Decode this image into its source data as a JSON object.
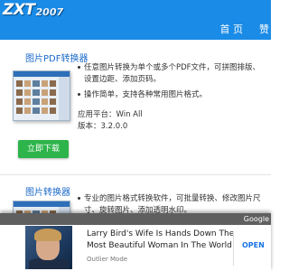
{
  "header": {
    "logo_main": "ZXT",
    "logo_year": "2007",
    "nav": [
      "首 页",
      "赞"
    ]
  },
  "products": [
    {
      "title": "图片PDF转换器",
      "bullets": [
        "任意图片转换为单个或多个PDF文件，可拼图排版、设置边距、添加页码。",
        "操作简单，支持各种常用图片格式。"
      ],
      "platform": "应用平台：Win All",
      "version": "版本：3.2.0.0",
      "download_label": "立即下载"
    },
    {
      "title": "图片转换器",
      "bullets": [
        "专业的图片格式转换软件，可批量转换、修改图片尺寸、旋转图片、添加透明水印。"
      ]
    }
  ],
  "ad": {
    "provider": "Google",
    "headline": "Larry Bird's Wife Is Hands Down The Most Beautiful Woman In The World",
    "source": "Outlier Mode",
    "cta": "OPEN"
  },
  "colors": {
    "header": "#1a8be6",
    "title": "#1b6ac9",
    "download": "#2db44a",
    "ad_cta": "#1a73e8"
  }
}
